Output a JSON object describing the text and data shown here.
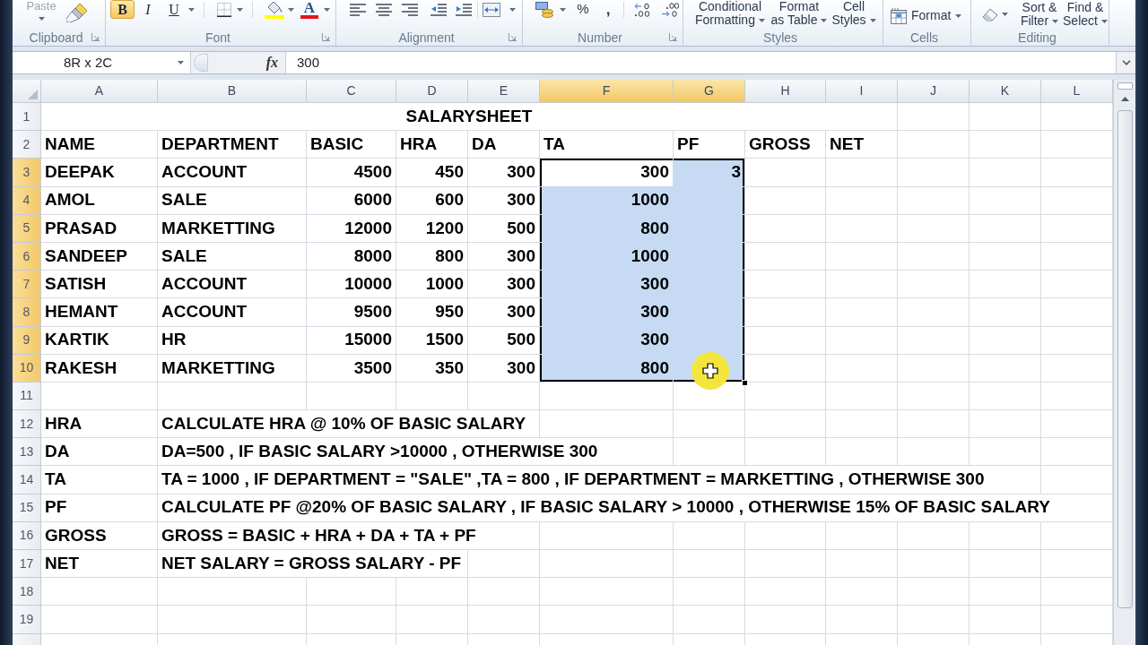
{
  "ribbon": {
    "clipboard": {
      "paste": "Paste",
      "label": "Clipboard"
    },
    "font": {
      "label": "Font",
      "styles": [
        {
          "kind": "bold",
          "text": "B",
          "on": true
        },
        {
          "kind": "italic",
          "text": "I",
          "on": false
        },
        {
          "kind": "underline",
          "text": "U",
          "on": false
        }
      ],
      "font_color": "A"
    },
    "alignment": {
      "label": "Alignment"
    },
    "number": {
      "label": "Number",
      "percent": "%",
      "comma": ","
    },
    "styles": {
      "label": "Styles",
      "buttons": [
        {
          "lines": [
            "Conditional",
            "Formatting"
          ]
        },
        {
          "lines": [
            "Format",
            "as Table"
          ]
        },
        {
          "lines": [
            "Cell",
            "Styles"
          ]
        }
      ]
    },
    "cells": {
      "label": "Cells",
      "format": "Format"
    },
    "editing": {
      "label": "Editing",
      "buttons": [
        {
          "lines": [
            "Sort &",
            "Filter"
          ]
        },
        {
          "lines": [
            "Find &",
            "Select"
          ]
        }
      ]
    }
  },
  "formula_bar": {
    "name_box": "8R x 2C",
    "function": "fx",
    "formula": "300"
  },
  "sheet": {
    "columns": [
      {
        "label": "A",
        "selected": false
      },
      {
        "label": "B",
        "selected": false
      },
      {
        "label": "C",
        "selected": false
      },
      {
        "label": "D",
        "selected": false
      },
      {
        "label": "E",
        "selected": false
      },
      {
        "label": "F",
        "selected": true
      },
      {
        "label": "G",
        "selected": true
      },
      {
        "label": "H",
        "selected": false
      },
      {
        "label": "I",
        "selected": false
      },
      {
        "label": "J",
        "selected": false
      },
      {
        "label": "K",
        "selected": false
      },
      {
        "label": "L",
        "selected": false
      }
    ],
    "rows": [
      {
        "label": "1",
        "selected": false,
        "cells": [
          {
            "kind": "title",
            "text": "SALARYSHEET",
            "active": false
          },
          {
            "kind": "merged"
          },
          {
            "kind": "merged"
          },
          {
            "kind": "merged"
          },
          {
            "kind": "merged"
          },
          {
            "kind": "merged"
          },
          {
            "kind": "merged"
          },
          {
            "kind": "merged"
          },
          {
            "kind": "merged"
          }
        ]
      },
      {
        "label": "2",
        "selected": false,
        "cells": [
          {
            "kind": "text",
            "text": "NAME",
            "active": false
          },
          {
            "kind": "text",
            "text": "DEPARTMENT",
            "active": false
          },
          {
            "kind": "text",
            "text": "BASIC",
            "active": false
          },
          {
            "kind": "text",
            "text": "HRA",
            "active": false
          },
          {
            "kind": "text",
            "text": "DA",
            "active": false
          },
          {
            "kind": "text",
            "text": "TA",
            "active": false
          },
          {
            "kind": "text",
            "text": "PF",
            "active": false
          },
          {
            "kind": "text",
            "text": "GROSS",
            "active": false
          },
          {
            "kind": "text",
            "text": "NET",
            "active": false
          }
        ]
      },
      {
        "label": "3",
        "selected": true,
        "cells": [
          {
            "kind": "text",
            "text": "DEEPAK",
            "active": false
          },
          {
            "kind": "text",
            "text": "ACCOUNT",
            "active": false
          },
          {
            "kind": "number",
            "text": "4500",
            "active": false
          },
          {
            "kind": "number",
            "text": "450",
            "active": false
          },
          {
            "kind": "number",
            "text": "300",
            "active": false
          },
          {
            "kind": "number",
            "text": "300",
            "active": true
          },
          {
            "kind": "number",
            "text": "3",
            "active": false
          }
        ]
      },
      {
        "label": "4",
        "selected": true,
        "cells": [
          {
            "kind": "text",
            "text": "AMOL",
            "active": false
          },
          {
            "kind": "text",
            "text": "SALE",
            "active": false
          },
          {
            "kind": "number",
            "text": "6000",
            "active": false
          },
          {
            "kind": "number",
            "text": "600",
            "active": false
          },
          {
            "kind": "number",
            "text": "300",
            "active": false
          },
          {
            "kind": "number",
            "text": "1000",
            "active": false
          }
        ]
      },
      {
        "label": "5",
        "selected": true,
        "cells": [
          {
            "kind": "text",
            "text": "PRASAD",
            "active": false
          },
          {
            "kind": "text",
            "text": "MARKETTING",
            "active": false
          },
          {
            "kind": "number",
            "text": "12000",
            "active": false
          },
          {
            "kind": "number",
            "text": "1200",
            "active": false
          },
          {
            "kind": "number",
            "text": "500",
            "active": false
          },
          {
            "kind": "number",
            "text": "800",
            "active": false
          }
        ]
      },
      {
        "label": "6",
        "selected": true,
        "cells": [
          {
            "kind": "text",
            "text": "SANDEEP",
            "active": false
          },
          {
            "kind": "text",
            "text": "SALE",
            "active": false
          },
          {
            "kind": "number",
            "text": "8000",
            "active": false
          },
          {
            "kind": "number",
            "text": "800",
            "active": false
          },
          {
            "kind": "number",
            "text": "300",
            "active": false
          },
          {
            "kind": "number",
            "text": "1000",
            "active": false
          }
        ]
      },
      {
        "label": "7",
        "selected": true,
        "cells": [
          {
            "kind": "text",
            "text": "SATISH",
            "active": false
          },
          {
            "kind": "text",
            "text": "ACCOUNT",
            "active": false
          },
          {
            "kind": "number",
            "text": "10000",
            "active": false
          },
          {
            "kind": "number",
            "text": "1000",
            "active": false
          },
          {
            "kind": "number",
            "text": "300",
            "active": false
          },
          {
            "kind": "number",
            "text": "300",
            "active": false
          }
        ]
      },
      {
        "label": "8",
        "selected": true,
        "cells": [
          {
            "kind": "text",
            "text": "HEMANT",
            "active": false
          },
          {
            "kind": "text",
            "text": "ACCOUNT",
            "active": false
          },
          {
            "kind": "number",
            "text": "9500",
            "active": false
          },
          {
            "kind": "number",
            "text": "950",
            "active": false
          },
          {
            "kind": "number",
            "text": "300",
            "active": false
          },
          {
            "kind": "number",
            "text": "300",
            "active": false
          }
        ]
      },
      {
        "label": "9",
        "selected": true,
        "cells": [
          {
            "kind": "text",
            "text": "KARTIK",
            "active": false
          },
          {
            "kind": "text",
            "text": "HR",
            "active": false
          },
          {
            "kind": "number",
            "text": "15000",
            "active": false
          },
          {
            "kind": "number",
            "text": "1500",
            "active": false
          },
          {
            "kind": "number",
            "text": "500",
            "active": false
          },
          {
            "kind": "number",
            "text": "300",
            "active": false
          }
        ]
      },
      {
        "label": "10",
        "selected": true,
        "cells": [
          {
            "kind": "text",
            "text": "RAKESH",
            "active": false
          },
          {
            "kind": "text",
            "text": "MARKETTING",
            "active": false
          },
          {
            "kind": "number",
            "text": "3500",
            "active": false
          },
          {
            "kind": "number",
            "text": "350",
            "active": false
          },
          {
            "kind": "number",
            "text": "300",
            "active": false
          },
          {
            "kind": "number",
            "text": "800",
            "active": false
          }
        ]
      },
      {
        "label": "11",
        "selected": false
      },
      {
        "label": "12",
        "selected": false,
        "cells": [
          {
            "kind": "text",
            "text": "HRA",
            "active": false
          },
          {
            "kind": "text",
            "text": "CALCULATE HRA @ 10% OF BASIC SALARY",
            "active": false
          }
        ]
      },
      {
        "label": "13",
        "selected": false,
        "cells": [
          {
            "kind": "text",
            "text": "DA",
            "active": false
          },
          {
            "kind": "text",
            "text": "DA=500 , IF BASIC SALARY >10000 , OTHERWISE 300",
            "active": false
          }
        ]
      },
      {
        "label": "14",
        "selected": false,
        "cells": [
          {
            "kind": "text",
            "text": "TA",
            "active": false
          },
          {
            "kind": "text",
            "text": "TA = 1000 , IF DEPARTMENT = \"SALE\" ,TA = 800 , IF DEPARTMENT = MARKETTING , OTHERWISE 300",
            "active": false
          }
        ]
      },
      {
        "label": "15",
        "selected": false,
        "cells": [
          {
            "kind": "text",
            "text": "PF",
            "active": false
          },
          {
            "kind": "text",
            "text": "CALCULATE PF @20% OF BASIC SALARY , IF BASIC SALARY > 10000 , OTHERWISE 15% OF BASIC SALARY",
            "active": false
          }
        ]
      },
      {
        "label": "16",
        "selected": false,
        "cells": [
          {
            "kind": "text",
            "text": "GROSS",
            "active": false
          },
          {
            "kind": "text",
            "text": "GROSS = BASIC + HRA + DA + TA + PF",
            "active": false
          }
        ]
      },
      {
        "label": "17",
        "selected": false,
        "cells": [
          {
            "kind": "text",
            "text": "NET",
            "active": false
          },
          {
            "kind": "text",
            "text": "NET SALARY = GROSS SALARY - PF",
            "active": false
          }
        ]
      },
      {
        "label": "18",
        "selected": false
      },
      {
        "label": "19",
        "selected": false
      }
    ]
  }
}
